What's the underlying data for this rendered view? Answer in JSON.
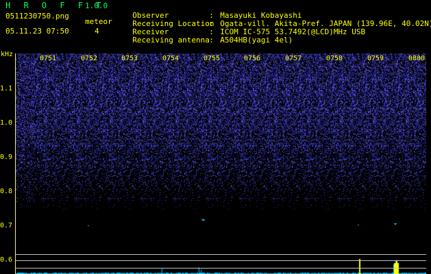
{
  "header": {
    "brand": "H R O F F T",
    "version": "1.0.0",
    "filename": "0511230750.png",
    "datetime": "05.11.23 07:50",
    "meteor_label": "meteor",
    "meteor_count": "4"
  },
  "info": [
    {
      "key": "Observer",
      "sep": ":",
      "value": "Masayuki Kobayashi"
    },
    {
      "key": "Receiving Location",
      "sep": ":",
      "value": "Ogata-vill. Akita-Pref. JAPAN (139.96E, 40.02N)"
    },
    {
      "key": "Receiver",
      "sep": ":",
      "value": "ICOM IC-575 53.7492(@LCD)MHz USB"
    },
    {
      "key": "Receiving antenna",
      "sep": ":",
      "value": "A504HB(yagi 4el)"
    }
  ],
  "axis": {
    "unit": "kHz",
    "y_ticks": [
      "1.1",
      "1.0",
      "0.9",
      "0.8",
      "0.7",
      "0.6"
    ],
    "time_ticks": [
      "0751",
      "0752",
      "0753",
      "0754",
      "0755",
      "0756",
      "0757",
      "0758",
      "0759",
      "0800"
    ]
  },
  "colors": {
    "text": "#ffff00",
    "brand": "#00ff66",
    "noise": "#3a3aff",
    "signal": "#00c8ff",
    "amp_peak": "#ffff00"
  }
}
